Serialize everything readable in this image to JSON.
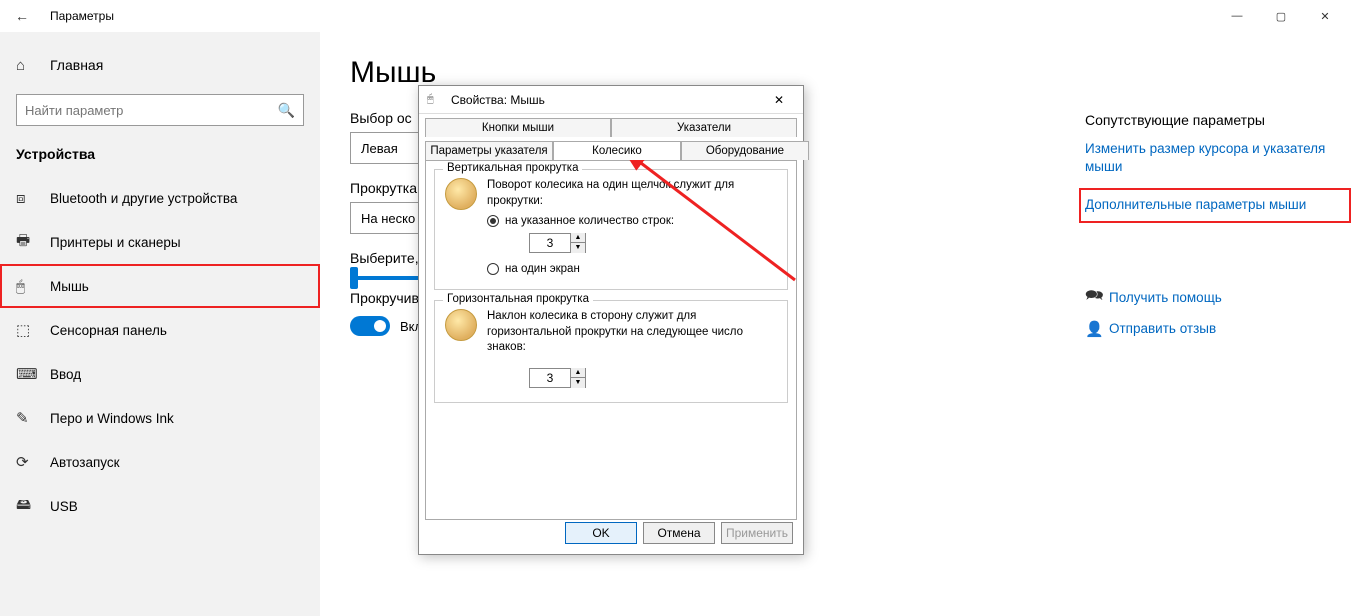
{
  "titlebar": {
    "title": "Параметры"
  },
  "sidebar": {
    "home": "Главная",
    "search_placeholder": "Найти параметр",
    "group": "Устройства",
    "items": [
      {
        "icon": "⧈",
        "label": "Bluetooth и другие устройства"
      },
      {
        "icon": "🖶",
        "label": "Принтеры и сканеры"
      },
      {
        "icon": "🖱",
        "label": "Мышь"
      },
      {
        "icon": "⬚",
        "label": "Сенсорная панель"
      },
      {
        "icon": "⌨",
        "label": "Ввод"
      },
      {
        "icon": "✎",
        "label": "Перо и Windows Ink"
      },
      {
        "icon": "⟳",
        "label": "Автозапуск"
      },
      {
        "icon": "🖴",
        "label": "USB"
      }
    ]
  },
  "main": {
    "title": "Мышь",
    "primary_button_label": "Выбор основной кнопки",
    "primary_button_value": "Левая",
    "scroll_label": "Прокрутка",
    "scroll_value": "На несколько",
    "lines_label": "Выберите,",
    "toggle_label": "Прокручивать",
    "toggle_value": "Вкл."
  },
  "related": {
    "title": "Сопутствующие параметры",
    "links": [
      "Изменить размер курсора и указателя мыши",
      "Дополнительные параметры мыши"
    ],
    "help": "Получить помощь",
    "feedback": "Отправить отзыв"
  },
  "dialog": {
    "title": "Свойства: Мышь",
    "tabs_row1": [
      "Кнопки мыши",
      "Указатели"
    ],
    "tabs_row2": [
      "Параметры указателя",
      "Колесико",
      "Оборудование"
    ],
    "vscroll": {
      "legend": "Вертикальная прокрутка",
      "desc": "Поворот колесика на один щелчок служит для прокрутки:",
      "opt1": "на указанное количество строк:",
      "value": "3",
      "opt2": "на один экран"
    },
    "hscroll": {
      "legend": "Горизонтальная прокрутка",
      "desc": "Наклон колесика в сторону служит для горизонтальной прокрутки на следующее число знаков:",
      "value": "3"
    },
    "buttons": {
      "ok": "OK",
      "cancel": "Отмена",
      "apply": "Применить"
    }
  }
}
